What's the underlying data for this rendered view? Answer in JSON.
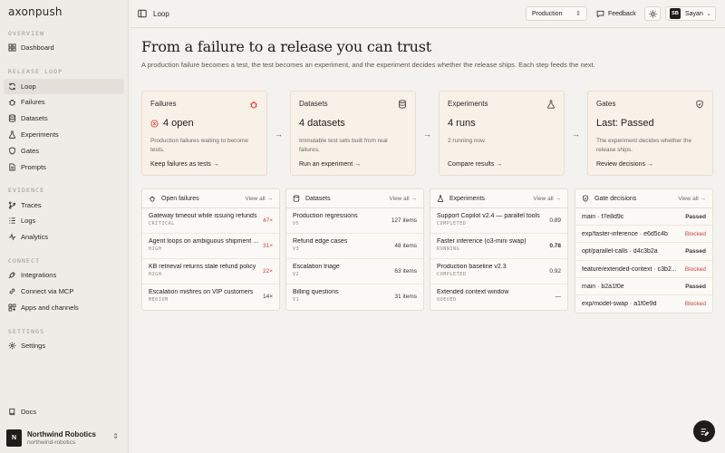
{
  "brand": "axonpush",
  "sidebar": {
    "sections": [
      {
        "label": "OVERVIEW"
      },
      {
        "label": "RELEASE LOOP"
      },
      {
        "label": "EVIDENCE"
      },
      {
        "label": "CONNECT"
      },
      {
        "label": "SETTINGS"
      }
    ],
    "items": [
      {
        "label": "Dashboard",
        "icon": "grid-icon"
      },
      {
        "label": "Loop",
        "icon": "refresh-icon",
        "active": true
      },
      {
        "label": "Failures",
        "icon": "bug-icon"
      },
      {
        "label": "Datasets",
        "icon": "database-icon"
      },
      {
        "label": "Experiments",
        "icon": "flask-icon"
      },
      {
        "label": "Gates",
        "icon": "shield-icon"
      },
      {
        "label": "Prompts",
        "icon": "file-icon"
      },
      {
        "label": "Traces",
        "icon": "branch-icon"
      },
      {
        "label": "Logs",
        "icon": "log-icon"
      },
      {
        "label": "Analytics",
        "icon": "activity-icon"
      },
      {
        "label": "Integrations",
        "icon": "plug-icon"
      },
      {
        "label": "Connect via MCP",
        "icon": "link-icon"
      },
      {
        "label": "Apps and channels",
        "icon": "apps-icon"
      },
      {
        "label": "Settings",
        "icon": "gear-icon"
      },
      {
        "label": "Docs",
        "icon": "book-icon"
      }
    ],
    "org": {
      "initial": "N",
      "name": "Northwind Robotics",
      "slug": "northwind-robotics"
    }
  },
  "topbar": {
    "crumb": "Loop",
    "environment": "Production",
    "feedback": "Feedback",
    "user_initials": "SB",
    "user_name": "Sayan"
  },
  "page": {
    "title": "From a failure to a release you can trust",
    "subtitle": "A production failure becomes a test, the test becomes an experiment, and the experiment decides whether the release ships. Each step feeds the next."
  },
  "steps": [
    {
      "title": "Failures",
      "stat": "4 open",
      "desc": "Production failures waiting to become tests.",
      "link": "Keep failures as tests →"
    },
    {
      "title": "Datasets",
      "stat": "4 datasets",
      "desc": "Immutable test sets built from real failures.",
      "link": "Run an experiment →"
    },
    {
      "title": "Experiments",
      "stat": "4 runs",
      "desc": "2 running now.",
      "link": "Compare results →"
    },
    {
      "title": "Gates",
      "stat": "Last: Passed",
      "desc": "The experiment decides whether the release ships.",
      "link": "Review decisions →"
    }
  ],
  "panels": {
    "view_all": "View all →",
    "failures": {
      "title": "Open failures",
      "rows": [
        {
          "title": "Gateway timeout while issuing refunds",
          "sub": "CRITICAL",
          "count": "47×"
        },
        {
          "title": "Agent loops on ambiguous shipment ...",
          "sub": "HIGH",
          "count": "31×"
        },
        {
          "title": "KB retrieval returns stale refund policy",
          "sub": "HIGH",
          "count": "22×"
        },
        {
          "title": "Escalation misfires on VIP customers",
          "sub": "MEDIUM",
          "count": "14×"
        }
      ]
    },
    "datasets": {
      "title": "Datasets",
      "rows": [
        {
          "title": "Production regressions",
          "sub": "V5",
          "count": "127 items"
        },
        {
          "title": "Refund edge cases",
          "sub": "V3",
          "count": "48 items"
        },
        {
          "title": "Escalation triage",
          "sub": "V2",
          "count": "63 items"
        },
        {
          "title": "Billing questions",
          "sub": "V1",
          "count": "31 items"
        }
      ]
    },
    "experiments": {
      "title": "Experiments",
      "rows": [
        {
          "title": "Support Copilot v2.4 — parallel tools",
          "sub": "COMPLETED",
          "score": "0.89"
        },
        {
          "title": "Faster inference (o3-mini swap)",
          "sub": "RUNNING",
          "score": "0.78"
        },
        {
          "title": "Production baseline v2.3",
          "sub": "COMPLETED",
          "score": "0.92"
        },
        {
          "title": "Extended context window",
          "sub": "QUEUED",
          "score": "—"
        }
      ]
    },
    "gates": {
      "title": "Gate decisions",
      "rows": [
        {
          "title": "main · f7e8d9c",
          "status": "Passed"
        },
        {
          "title": "exp/faster-inference · e6d5c4b",
          "status": "Blocked"
        },
        {
          "title": "opt/parallel-calls · d4c3b2a",
          "status": "Passed"
        },
        {
          "title": "feature/extended-context · c3b2...",
          "status": "Blocked"
        },
        {
          "title": "main · b2a1f0e",
          "status": "Passed"
        },
        {
          "title": "exp/model-swap · a1f0e9d",
          "status": "Blocked"
        }
      ]
    }
  },
  "colors": {
    "blocked": "#c8413a",
    "card_bg": "#f7f1e8",
    "accent_red": "#d8443a"
  }
}
